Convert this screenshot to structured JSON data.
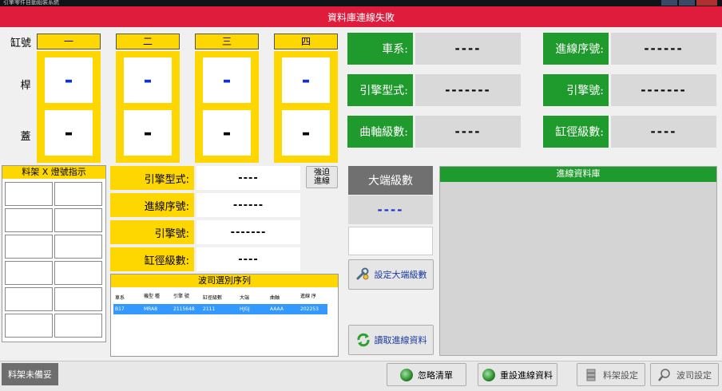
{
  "window": {
    "title": "引擎零件自動組裝系統"
  },
  "banner": {
    "text": "資料庫連線失敗"
  },
  "cylinders": {
    "row_labels": {
      "cylinder": "缸號",
      "rod": "桿",
      "cap": "蓋"
    },
    "columns": [
      {
        "name": "一",
        "rod": "-",
        "cap": "-"
      },
      {
        "name": "二",
        "rod": "-",
        "cap": "-"
      },
      {
        "name": "三",
        "rod": "-",
        "cap": "-"
      },
      {
        "name": "四",
        "rod": "-",
        "cap": "-"
      }
    ]
  },
  "info": {
    "car_series_label": "車系:",
    "car_series_value": "----",
    "engine_model_label": "引擎型式:",
    "engine_model_value": "-------",
    "crank_grade_label": "曲軸級數:",
    "crank_grade_value": "----",
    "seq_label": "進線序號:",
    "seq_value": "------",
    "engine_no_label": "引擎號:",
    "engine_no_value": "-------",
    "bore_grade_label": "缸徑級數:",
    "bore_grade_value": "----"
  },
  "rack": {
    "title": "料架 X 燈號指示",
    "status": "料架未備妥"
  },
  "middle": {
    "engine_model_label": "引擎型式:",
    "engine_model_value": "----",
    "seq_label": "進線序號:",
    "seq_value": "------",
    "engine_no_label": "引擎號:",
    "engine_no_value": "-------",
    "bore_grade_label": "缸徑級數:",
    "bore_grade_value": "----",
    "force_button": "強迫進線"
  },
  "order_list": {
    "title": "波司選別序列",
    "headers": [
      "車系",
      "機型 種",
      "引擎 號",
      "缸徑級數",
      "大端",
      "曲軸",
      "進線 序"
    ],
    "rows": [
      [
        "B17",
        "MRA8",
        "2115648",
        "2111",
        "HJGJ",
        "AAAA",
        "202253"
      ]
    ]
  },
  "big_end": {
    "label": "大端級數",
    "value": "----",
    "set_button": "設定大端級數",
    "read_button": "讀取進線資料"
  },
  "db_panel": {
    "title": "進線資料庫"
  },
  "bottom_buttons": {
    "ignore": "忽略清單",
    "reset": "重設進線資料",
    "rack_settings": "料架設定",
    "bosch_settings": "波司設定"
  },
  "colors": {
    "banner": "#e01c3c",
    "green": "#1f9a2c",
    "yellow": "#ffd700",
    "blue_text": "#1030d0",
    "gray_header": "#707070",
    "selected_row": "#3399ff"
  }
}
